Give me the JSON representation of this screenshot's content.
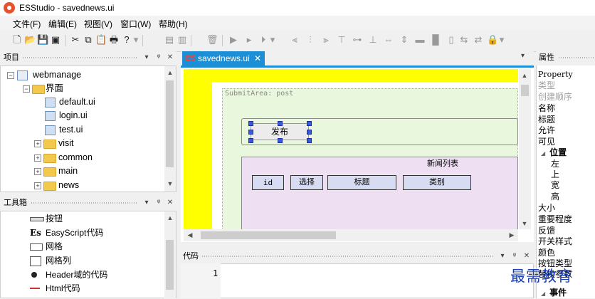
{
  "window": {
    "title": "ESStudio - savednews.ui"
  },
  "menu": [
    "文件(F)",
    "编辑(E)",
    "视图(V)",
    "窗口(W)",
    "帮助(H)"
  ],
  "panels": {
    "project": {
      "title": "项目"
    },
    "toolbox": {
      "title": "工具箱"
    },
    "code": {
      "title": "代码"
    },
    "properties": {
      "title": "属性"
    }
  },
  "project_tree": {
    "root": "webmanage",
    "folder": "界面",
    "files": [
      "default.ui",
      "login.ui",
      "test.ui"
    ],
    "folders": [
      "visit",
      "common",
      "main",
      "news"
    ]
  },
  "toolbox_items": [
    {
      "icon": "button-icon",
      "label": "按钮"
    },
    {
      "icon": "easyscript-icon",
      "glyph": "Es",
      "label": "EasyScript代码"
    },
    {
      "icon": "grid-icon",
      "label": "网格"
    },
    {
      "icon": "grid-column-icon",
      "label": "网格列"
    },
    {
      "icon": "header-code-icon",
      "label": "Header域的代码"
    },
    {
      "icon": "html-code-icon",
      "label": "Html代码"
    }
  ],
  "document": {
    "tab_label": "savednews.ui",
    "tab_badge": "ES",
    "submit_area_label": "SubmitArea: post",
    "publish_button": "发布",
    "news_list_title": "新闻列表",
    "columns": [
      "id",
      "选择",
      "标题",
      "类别"
    ]
  },
  "code": {
    "line_numbers": [
      "1"
    ]
  },
  "properties": {
    "header": "Property",
    "items": [
      {
        "label": "类型",
        "style": "gray"
      },
      {
        "label": "创建顺序",
        "style": "gray"
      },
      {
        "label": "名称",
        "style": "normal"
      },
      {
        "label": "标题",
        "style": "normal"
      },
      {
        "label": "允许",
        "style": "normal"
      },
      {
        "label": "可见",
        "style": "normal"
      },
      {
        "label": "位置",
        "style": "group"
      },
      {
        "label": "左",
        "style": "indent"
      },
      {
        "label": "上",
        "style": "indent"
      },
      {
        "label": "宽",
        "style": "indent"
      },
      {
        "label": "高",
        "style": "indent"
      },
      {
        "label": "大小",
        "style": "normal"
      },
      {
        "label": "重要程度",
        "style": "normal"
      },
      {
        "label": "反馈",
        "style": "normal"
      },
      {
        "label": "开关样式",
        "style": "normal"
      },
      {
        "label": "颜色",
        "style": "normal"
      },
      {
        "label": "按钮类型",
        "style": "normal"
      },
      {
        "label": "替换参数",
        "style": "normal"
      },
      {
        "label": "事件",
        "style": "group"
      }
    ]
  },
  "watermark": "最需教育",
  "colors": {
    "accent": "#1c8fd6",
    "yellow_frame": "#ffff00",
    "submit_bg": "#e9f7dc",
    "table_bg": "#efdff3",
    "header_cell": "#d8dcf2"
  }
}
